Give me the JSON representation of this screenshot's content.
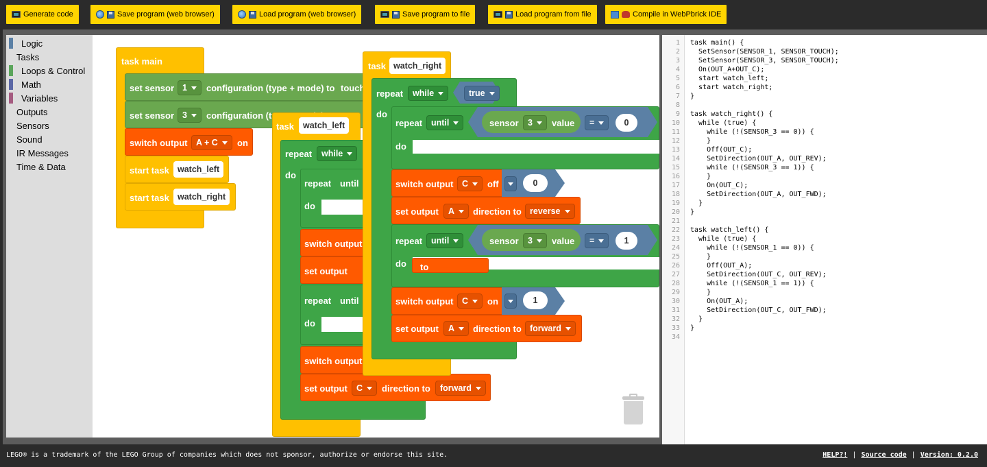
{
  "toolbar": {
    "buttons": [
      {
        "label": "Generate code",
        "icons": [
          "monitor-icon"
        ]
      },
      {
        "label": "Save program (web browser)",
        "icons": [
          "globe-icon",
          "floppy-disk-icon"
        ]
      },
      {
        "label": "Load program (web browser)",
        "icons": [
          "globe-icon",
          "floppy-disk-icon"
        ]
      },
      {
        "label": "Save program to file",
        "icons": [
          "monitor-icon",
          "floppy-disk-icon"
        ]
      },
      {
        "label": "Load program from file",
        "icons": [
          "monitor-icon",
          "floppy-disk-icon"
        ]
      },
      {
        "label": "Compile in WebPbrick IDE",
        "icons": [
          "box-icon",
          "gear-icon"
        ]
      }
    ]
  },
  "toolbox": {
    "categories": [
      {
        "label": "Logic",
        "color": "#5b80a5"
      },
      {
        "label": "Tasks",
        "color": ""
      },
      {
        "label": "Loops & Control",
        "color": "#5ba55b"
      },
      {
        "label": "Math",
        "color": "#5b67a5"
      },
      {
        "label": "Variables",
        "color": "#a55b80"
      },
      {
        "label": "Outputs",
        "color": ""
      },
      {
        "label": "Sensors",
        "color": ""
      },
      {
        "label": "Sound",
        "color": ""
      },
      {
        "label": "IR Messages",
        "color": ""
      },
      {
        "label": "Time & Data",
        "color": ""
      }
    ]
  },
  "blocks": {
    "task_main": {
      "header": "task main",
      "set_sensor_label": "set sensor",
      "sensor1": "1",
      "sensor3": "3",
      "config_label": "configuration (type + mode) to",
      "config_value": "touch",
      "switch_output_label": "switch output",
      "switch_output_value": "A + C",
      "switch_output_state": "on",
      "start_task_label": "start task",
      "start_task_1": "watch_left",
      "start_task_2": "watch_right"
    },
    "task_left": {
      "task_label": "task",
      "name": "watch_left",
      "repeat_label": "repeat",
      "repeat_mode": "while",
      "do_label": "do",
      "until_label": "until",
      "switch_output_label": "switch output",
      "set_output_label": "set output",
      "set_output_port": "C",
      "direction_label": "direction to",
      "direction_value": "forward"
    },
    "task_right": {
      "task_label": "task",
      "name": "watch_right",
      "repeat_label": "repeat",
      "repeat_mode": "while",
      "cond_true": "true",
      "do_label": "do",
      "until_label": "until",
      "sensor_label": "sensor",
      "sensor_port": "3",
      "value_label": "value",
      "op": "=",
      "val0": "0",
      "val1": "1",
      "switch_output_label": "switch output",
      "port_c": "C",
      "off": "off",
      "on": "on",
      "set_output_label": "set output",
      "port_a": "A",
      "direction_label": "direction to",
      "reverse": "reverse",
      "forward": "forward",
      "to_label": "to"
    }
  },
  "code": {
    "lines": [
      "task main() {",
      "  SetSensor(SENSOR_1, SENSOR_TOUCH);",
      "  SetSensor(SENSOR_3, SENSOR_TOUCH);",
      "  On(OUT_A+OUT_C);",
      "  start watch_left;",
      "  start watch_right;",
      "}",
      "",
      "task watch_right() {",
      "  while (true) {",
      "    while (!(SENSOR_3 == 0)) {",
      "    }",
      "    Off(OUT_C);",
      "    SetDirection(OUT_A, OUT_REV);",
      "    while (!(SENSOR_3 == 1)) {",
      "    }",
      "    On(OUT_C);",
      "    SetDirection(OUT_A, OUT_FWD);",
      "  }",
      "}",
      "",
      "task watch_left() {",
      "  while (true) {",
      "    while (!(SENSOR_1 == 0)) {",
      "    }",
      "    Off(OUT_A);",
      "    SetDirection(OUT_C, OUT_REV);",
      "    while (!(SENSOR_1 == 1)) {",
      "    }",
      "    On(OUT_A);",
      "    SetDirection(OUT_C, OUT_FWD);",
      "  }",
      "}",
      ""
    ]
  },
  "footer": {
    "notice": "LEGO® is a trademark of the LEGO Group of companies which does not sponsor, authorize or endorse this site.",
    "help": "HELP?!",
    "separator": "|",
    "source": "Source code",
    "version": "Version: 0.2.0"
  }
}
